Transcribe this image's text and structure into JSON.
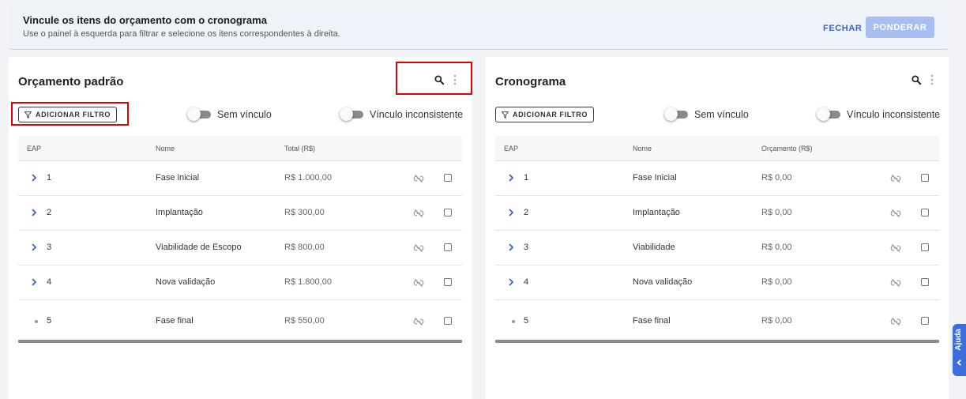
{
  "banner": {
    "title": "Vincule os itens do orçamento com o cronograma",
    "subtitle": "Use o painel à esquerda para filtrar e selecione os itens correspondentes à direita.",
    "close_label": "FECHAR",
    "weigh_label": "PONDERAR"
  },
  "left_panel": {
    "title": "Orçamento padrão",
    "filter_label": "ADICIONAR FILTRO",
    "toggle_unlinked": "Sem vínculo",
    "toggle_inconsistent": "Vínculo inconsistente",
    "columns": {
      "eap": "EAP",
      "name": "Nome",
      "value": "Total (R$)"
    },
    "rows": [
      {
        "eap": "1",
        "name": "Fase inicial",
        "value": "R$ 1.000,00"
      },
      {
        "eap": "2",
        "name": "Implantação",
        "value": "R$ 300,00"
      },
      {
        "eap": "3",
        "name": "Viabilidade de Escopo",
        "value": "R$ 800,00"
      },
      {
        "eap": "4",
        "name": "Nova validação",
        "value": "R$ 1.800,00"
      },
      {
        "eap": "5",
        "name": "Fase final",
        "value": "R$ 550,00"
      }
    ]
  },
  "right_panel": {
    "title": "Cronograma",
    "filter_label": "ADICIONAR FILTRO",
    "toggle_unlinked": "Sem vínculo",
    "toggle_inconsistent": "Vínculo inconsistente",
    "columns": {
      "eap": "EAP",
      "name": "Nome",
      "value": "Orçamento (R$)"
    },
    "rows": [
      {
        "eap": "1",
        "name": "Fase Inicial",
        "value": "R$ 0,00"
      },
      {
        "eap": "2",
        "name": "Implantação",
        "value": "R$ 0,00"
      },
      {
        "eap": "3",
        "name": "Viabilidade",
        "value": "R$ 0,00"
      },
      {
        "eap": "4",
        "name": "Nova validação",
        "value": "R$ 0,00"
      },
      {
        "eap": "5",
        "name": "Fase final",
        "value": "R$ 0,00"
      }
    ]
  },
  "help": {
    "label": "Ajuda"
  },
  "colors": {
    "accent": "#3a64c8",
    "disabled_button": "#a8bdf0",
    "highlight": "#e00000"
  },
  "icons": [
    "search-icon",
    "more-vert-icon",
    "filter-icon",
    "chevron-right-icon",
    "link-off-icon",
    "chevron-left-icon"
  ]
}
